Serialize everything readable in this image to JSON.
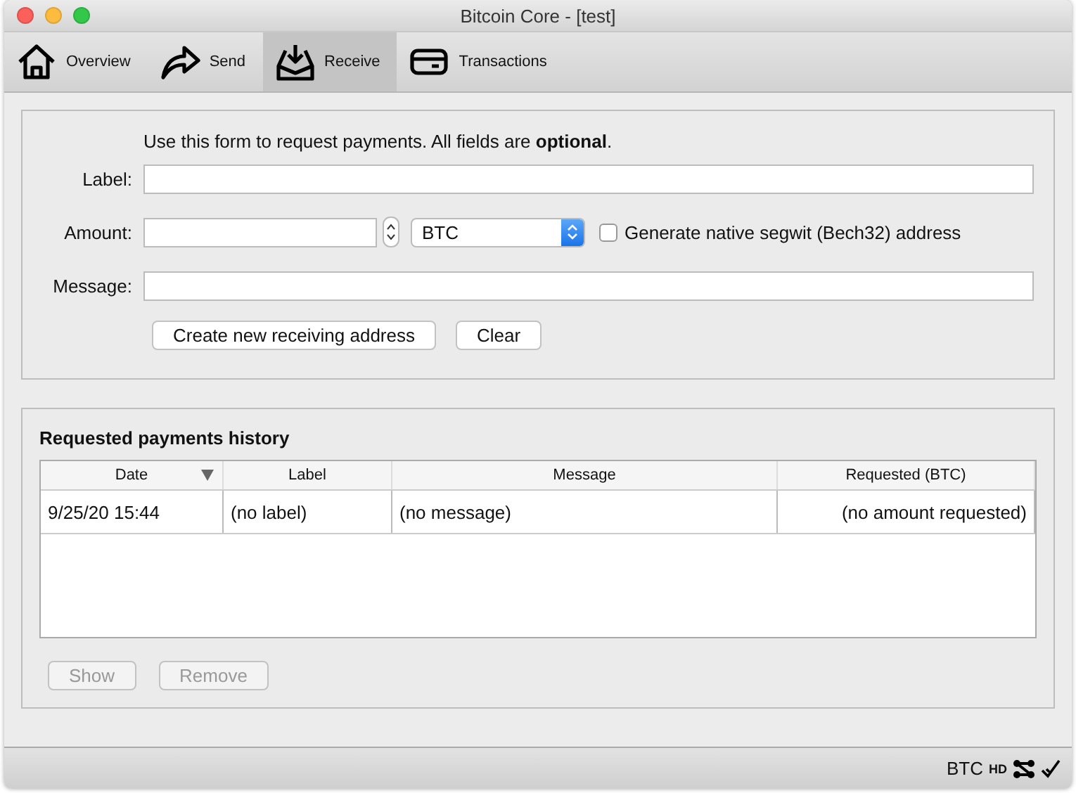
{
  "window": {
    "title": "Bitcoin Core - [test]"
  },
  "tabs": [
    {
      "label": "Overview",
      "kind": "home",
      "selected": false
    },
    {
      "label": "Send",
      "kind": "send",
      "selected": false
    },
    {
      "label": "Receive",
      "kind": "receive",
      "selected": true
    },
    {
      "label": "Transactions",
      "kind": "card",
      "selected": false
    }
  ],
  "form": {
    "intro": "Use this form to request payments. All fields are **optional**.",
    "label_field": {
      "label": "Label:"
    },
    "amount_field": {
      "label": "Amount:"
    },
    "unit_select": {
      "value": "BTC"
    },
    "segwit_checkbox": {
      "label": "Generate native segwit (Bech32) address",
      "checked": false
    },
    "message_field": {
      "label": "Message:"
    },
    "buttons": [
      {
        "label": "Create new receiving address",
        "disabled": false
      },
      {
        "label": "Clear",
        "disabled": false
      }
    ]
  },
  "history": {
    "title": "Requested payments history",
    "columns": [
      {
        "label": "Date",
        "sorted": true
      },
      {
        "label": "Label",
        "sorted": false
      },
      {
        "label": "Message",
        "sorted": false
      },
      {
        "label": "Requested (BTC)",
        "sorted": false
      }
    ],
    "rows": [
      [
        "9/25/20 15:44",
        "(no label)",
        "(no message)",
        "(no amount requested)"
      ]
    ],
    "buttons": [
      {
        "label": "Show",
        "disabled": true
      },
      {
        "label": "Remove",
        "disabled": true
      }
    ]
  },
  "status_bar": {
    "unit": "BTC",
    "hd": "HD"
  }
}
